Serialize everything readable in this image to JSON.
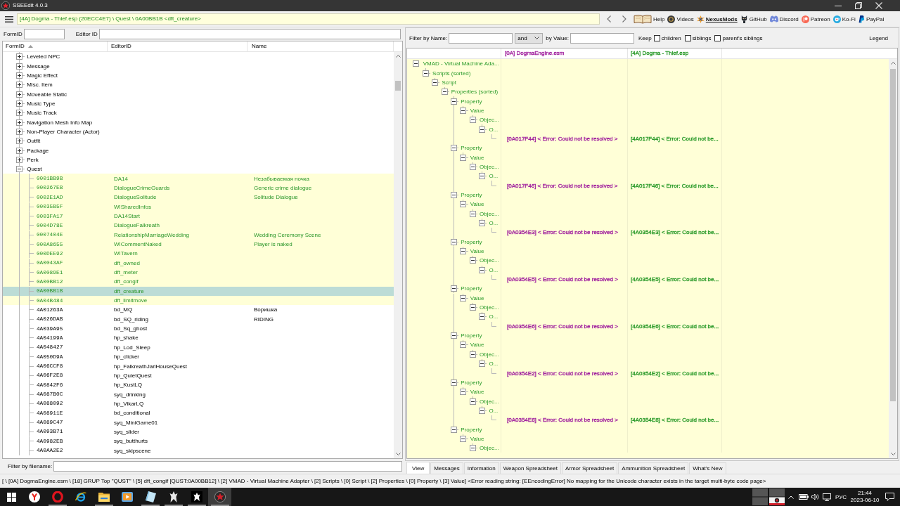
{
  "window": {
    "title": "SSEEdit 4.0.3"
  },
  "toolbar": {
    "path": "[4A] Dogma - Thief.esp (20ECC4E7) \\ Quest \\ 0A00BB1B <dft_creature>",
    "links": [
      {
        "label": "Help",
        "highlighted": false
      },
      {
        "label": "Videos",
        "highlighted": false
      },
      {
        "label": "NexusMods",
        "highlighted": true
      },
      {
        "label": "GitHub",
        "highlighted": false
      },
      {
        "label": "Discord",
        "highlighted": false
      },
      {
        "label": "Patreon",
        "highlighted": false
      },
      {
        "label": "Ko-Fi",
        "highlighted": false
      },
      {
        "label": "PayPal",
        "highlighted": false
      }
    ]
  },
  "record_filters": {
    "form_id_label": "FormID",
    "editor_id_label": "Editor ID"
  },
  "record_tree": {
    "columns": [
      {
        "label": "FormID",
        "sorted": true
      },
      {
        "label": "EditorID",
        "sorted": false
      },
      {
        "label": "Name",
        "sorted": false
      }
    ],
    "items": [
      {
        "label": "Leveled NPC",
        "expanded": false,
        "selected": false
      },
      {
        "label": "Message",
        "expanded": false,
        "selected": false
      },
      {
        "label": "Magic Effect",
        "expanded": false,
        "selected": false
      },
      {
        "label": "Misc. Item",
        "expanded": false,
        "selected": false
      },
      {
        "label": "Moveable Static",
        "expanded": false,
        "selected": false
      },
      {
        "label": "Music Type",
        "expanded": false,
        "selected": false
      },
      {
        "label": "Music Track",
        "expanded": false,
        "selected": false
      },
      {
        "label": "Navigation Mesh Info Map",
        "expanded": false,
        "selected": false
      },
      {
        "label": "Non-Player Character (Actor)",
        "expanded": false,
        "selected": false
      },
      {
        "label": "Outfit",
        "expanded": false,
        "selected": false
      },
      {
        "label": "Package",
        "expanded": false,
        "selected": false
      },
      {
        "label": "Perk",
        "expanded": false,
        "selected": false
      },
      {
        "label": "Quest",
        "expanded": true,
        "selected": false,
        "children": [
          {
            "form_id": "0001BB9B",
            "editor_id": "DA14",
            "name": "Незабываемая ночка",
            "highlighted": true,
            "selected": false
          },
          {
            "form_id": "000267EB",
            "editor_id": "DialogueCrimeGuards",
            "name": "Generic crime dialogue",
            "highlighted": true,
            "selected": false
          },
          {
            "form_id": "0002E1AD",
            "editor_id": "DialogueSolitude",
            "name": "Solitude Dialogue",
            "highlighted": true,
            "selected": false
          },
          {
            "form_id": "00035B5F",
            "editor_id": "WISharedInfos",
            "highlighted": true,
            "selected": false
          },
          {
            "form_id": "0003FA17",
            "editor_id": "DA14Start",
            "highlighted": true,
            "selected": false
          },
          {
            "form_id": "0004D78E",
            "editor_id": "DialogueFalkreath",
            "highlighted": true,
            "selected": false
          },
          {
            "form_id": "0007404E",
            "editor_id": "RelationshipMarriageWedding",
            "name": "Wedding Ceremony Scene",
            "highlighted": true,
            "selected": false
          },
          {
            "form_id": "000A8655",
            "editor_id": "WICommentNaked",
            "name": "Player is naked",
            "highlighted": true,
            "selected": false
          },
          {
            "form_id": "000DEE92",
            "editor_id": "WITavern",
            "highlighted": true,
            "selected": false
          },
          {
            "form_id": "0A0043AF",
            "editor_id": "dft_owned",
            "highlighted": true,
            "selected": false
          },
          {
            "form_id": "0A0089E1",
            "editor_id": "dft_meter",
            "highlighted": true,
            "selected": false
          },
          {
            "form_id": "0A00BB12",
            "editor_id": "dft_congif",
            "highlighted": true,
            "selected": false
          },
          {
            "form_id": "0A00BB1B",
            "editor_id": "dft_creature",
            "highlighted": true,
            "selected": true
          },
          {
            "form_id": "0A04B484",
            "editor_id": "dft_limitmove",
            "highlighted": true,
            "selected": false
          },
          {
            "form_id": "4A01263A",
            "editor_id": "bd_MQ",
            "name": "Воришка",
            "highlighted": false,
            "selected": false
          },
          {
            "form_id": "4A026DAB",
            "editor_id": "bd_SQ_riding",
            "name": "RIDING",
            "highlighted": false,
            "selected": false
          },
          {
            "form_id": "4A039A95",
            "editor_id": "bd_Sq_ghost",
            "highlighted": false,
            "selected": false
          },
          {
            "form_id": "4A04199A",
            "editor_id": "hp_shake",
            "highlighted": false,
            "selected": false
          },
          {
            "form_id": "4A048427",
            "editor_id": "hp_Lod_Sleep",
            "highlighted": false,
            "selected": false
          },
          {
            "form_id": "4A050D9A",
            "editor_id": "hp_clicker",
            "highlighted": false,
            "selected": false
          },
          {
            "form_id": "4A06CCF8",
            "editor_id": "hp_FalkreathJarlHouseQuest",
            "highlighted": false,
            "selected": false
          },
          {
            "form_id": "4A06F2E8",
            "editor_id": "hp_QuietQuest",
            "highlighted": false,
            "selected": false
          },
          {
            "form_id": "4A0842F6",
            "editor_id": "hp_KustLQ",
            "highlighted": false,
            "selected": false
          },
          {
            "form_id": "4A087B0C",
            "editor_id": "syq_drinking",
            "highlighted": false,
            "selected": false
          },
          {
            "form_id": "4A088092",
            "editor_id": "hp_VikarLQ",
            "highlighted": false,
            "selected": false
          },
          {
            "form_id": "4A08911E",
            "editor_id": "bd_conditional",
            "highlighted": false,
            "selected": false
          },
          {
            "form_id": "4A089C47",
            "editor_id": "syq_MiniGame01",
            "highlighted": false,
            "selected": false
          },
          {
            "form_id": "4A093B71",
            "editor_id": "syq_slider",
            "highlighted": false,
            "selected": false
          },
          {
            "form_id": "4A0982EB",
            "editor_id": "syq_butthurts",
            "highlighted": false,
            "selected": false
          },
          {
            "form_id": "4A0AA2E2",
            "editor_id": "syq_skipscene",
            "highlighted": false,
            "selected": false
          }
        ]
      }
    ]
  },
  "filename_filter": {
    "label": "Filter by filename:"
  },
  "view_filters": {
    "name_label": "Filter by Name:",
    "operator": "and",
    "value_label": "by Value:",
    "keep_label": "Keep",
    "keep_options": [
      {
        "label": "children",
        "checked": false
      },
      {
        "label": "siblings",
        "checked": false
      },
      {
        "label": "parent's siblings",
        "checked": false
      }
    ],
    "legend": "Legend"
  },
  "record_view": {
    "columns": [
      {
        "label": "[0A] DogmaEngine.esm",
        "color": "#a0209e"
      },
      {
        "label": "[4A] Dogma - Thief.esp",
        "color": "#2a9a2a"
      }
    ],
    "tree": [
      {
        "label": "VMAD - Virtual Machine Ada...",
        "expanded": true,
        "children": [
          {
            "label": "Scripts (sorted)",
            "expanded": true,
            "children": [
              {
                "label": "Script",
                "expanded": true,
                "children": [
                  {
                    "label": "Properties (sorted)",
                    "expanded": true,
                    "children": [
                      {
                        "label": "Property",
                        "expanded": true,
                        "children": [
                          {
                            "label": "Value",
                            "expanded": true,
                            "children": [
                              {
                                "label": "Objec...",
                                "expanded": true,
                                "children": [
                                  {
                                    "label": "O...",
                                    "expanded": true,
                                    "children": [
                                      {
                                        "values": [
                                          "[0A017F44] < Error: Could not be resolved >",
                                          "[4A017F44] < Error: Could not be..."
                                        ]
                                      }
                                    ]
                                  }
                                ]
                              }
                            ]
                          }
                        ]
                      },
                      {
                        "label": "Property",
                        "expanded": true,
                        "children": [
                          {
                            "label": "Value",
                            "expanded": true,
                            "children": [
                              {
                                "label": "Objec...",
                                "expanded": true,
                                "children": [
                                  {
                                    "label": "O...",
                                    "expanded": true,
                                    "children": [
                                      {
                                        "values": [
                                          "[0A017F46] < Error: Could not be resolved >",
                                          "[4A017F46] < Error: Could not be..."
                                        ]
                                      }
                                    ]
                                  }
                                ]
                              }
                            ]
                          }
                        ]
                      },
                      {
                        "label": "Property",
                        "expanded": true,
                        "children": [
                          {
                            "label": "Value",
                            "expanded": true,
                            "children": [
                              {
                                "label": "Objec...",
                                "expanded": true,
                                "children": [
                                  {
                                    "label": "O...",
                                    "expanded": true,
                                    "children": [
                                      {
                                        "values": [
                                          "[0A0354E3] < Error: Could not be resolved >",
                                          "[4A0354E3] < Error: Could not be..."
                                        ]
                                      }
                                    ]
                                  }
                                ]
                              }
                            ]
                          }
                        ]
                      },
                      {
                        "label": "Property",
                        "expanded": true,
                        "children": [
                          {
                            "label": "Value",
                            "expanded": true,
                            "children": [
                              {
                                "label": "Objec...",
                                "expanded": true,
                                "children": [
                                  {
                                    "label": "O...",
                                    "expanded": true,
                                    "children": [
                                      {
                                        "values": [
                                          "[0A0354E5] < Error: Could not be resolved >",
                                          "[4A0354E5] < Error: Could not be..."
                                        ]
                                      }
                                    ]
                                  }
                                ]
                              }
                            ]
                          }
                        ]
                      },
                      {
                        "label": "Property",
                        "expanded": true,
                        "children": [
                          {
                            "label": "Value",
                            "expanded": true,
                            "children": [
                              {
                                "label": "Objec...",
                                "expanded": true,
                                "children": [
                                  {
                                    "label": "O...",
                                    "expanded": true,
                                    "children": [
                                      {
                                        "values": [
                                          "[0A0354E6] < Error: Could not be resolved >",
                                          "[4A0354E6] < Error: Could not be..."
                                        ]
                                      }
                                    ]
                                  }
                                ]
                              }
                            ]
                          }
                        ]
                      },
                      {
                        "label": "Property",
                        "expanded": true,
                        "children": [
                          {
                            "label": "Value",
                            "expanded": true,
                            "children": [
                              {
                                "label": "Objec...",
                                "expanded": true,
                                "children": [
                                  {
                                    "label": "O...",
                                    "expanded": true,
                                    "children": [
                                      {
                                        "values": [
                                          "[0A0354E2] < Error: Could not be resolved >",
                                          "[4A0354E2] < Error: Could not be..."
                                        ]
                                      }
                                    ]
                                  }
                                ]
                              }
                            ]
                          }
                        ]
                      },
                      {
                        "label": "Property",
                        "expanded": true,
                        "children": [
                          {
                            "label": "Value",
                            "expanded": true,
                            "children": [
                              {
                                "label": "Objec...",
                                "expanded": true,
                                "children": [
                                  {
                                    "label": "O...",
                                    "expanded": true,
                                    "children": [
                                      {
                                        "values": [
                                          "[0A0354E8] < Error: Could not be resolved >",
                                          "[4A0354E8] < Error: Could not be..."
                                        ]
                                      }
                                    ]
                                  }
                                ]
                              }
                            ]
                          }
                        ]
                      },
                      {
                        "label": "Property",
                        "expanded": true,
                        "children": [
                          {
                            "label": "Value",
                            "expanded": true,
                            "children": [
                              {
                                "label": "Objec...",
                                "expanded": true
                              }
                            ]
                          }
                        ]
                      }
                    ]
                  }
                ]
              }
            ]
          }
        ]
      }
    ]
  },
  "tabs": [
    {
      "label": "View",
      "selected": true
    },
    {
      "label": "Messages",
      "selected": false
    },
    {
      "label": "Information",
      "selected": false
    },
    {
      "label": "Weapon Spreadsheet",
      "selected": false
    },
    {
      "label": "Armor Spreadsheet",
      "selected": false
    },
    {
      "label": "Ammunition Spreadsheet",
      "selected": false
    },
    {
      "label": "What's New",
      "selected": false
    }
  ],
  "status_bar": {
    "text": "[ \\ [0A] DogmaEngine.esm \\ [18] GRUP Top \"QUST\" \\ [5] dft_congif [QUST:0A00BB12] \\ [2] VMAD - Virtual Machine Adapter \\ [2] Scripts \\ [0] Script \\ [2] Properties \\ [0] Property \\ [3] Value] <Error reading string: [EEncodingError] No mapping for the Unicode character exists in the target multi-byte code page>"
  },
  "taskbar": {
    "apps": [
      {
        "selected": false,
        "open": false
      },
      {
        "selected": false,
        "open": true
      },
      {
        "selected": false,
        "open": false
      },
      {
        "selected": false,
        "open": true
      },
      {
        "selected": false,
        "open": false
      },
      {
        "selected": false,
        "open": true
      },
      {
        "selected": false,
        "open": true
      },
      {
        "selected": false,
        "open": true
      },
      {
        "selected": true,
        "open": true
      }
    ],
    "language": "РУС",
    "time": "21:44",
    "date": "2023-06-10"
  }
}
